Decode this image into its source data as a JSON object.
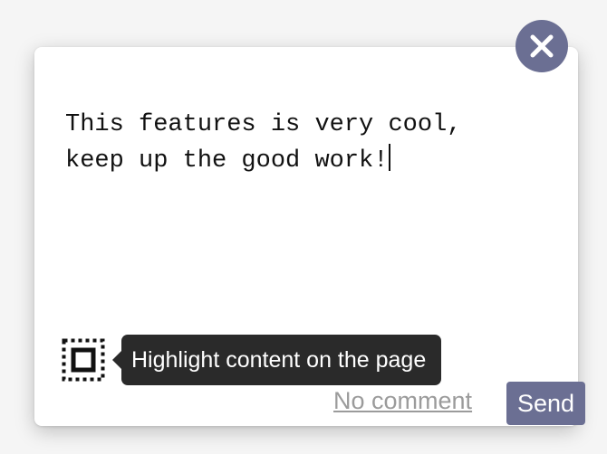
{
  "feedback": {
    "text": "This features is very cool,\nkeep up the good work!"
  },
  "actions": {
    "no_comment_label": "No comment",
    "send_label": "Send"
  },
  "tooltip": {
    "text": "Highlight content on the page"
  },
  "icons": {
    "close": "close-icon",
    "highlight": "highlight-select-icon"
  },
  "colors": {
    "accent": "#6b6f93",
    "tooltip_bg": "#2a2a2a",
    "link": "#9b9b9b",
    "card": "#ffffff",
    "text": "#111111"
  }
}
